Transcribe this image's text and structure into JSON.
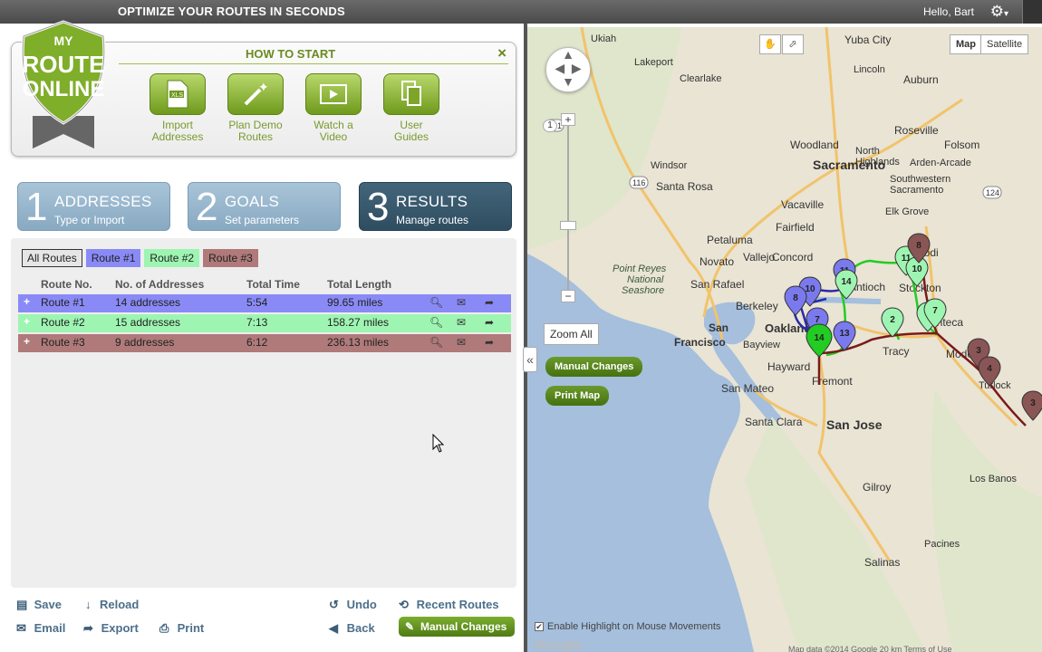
{
  "topbar": {
    "tagline": "OPTIMIZE YOUR ROUTES IN SECONDS",
    "greeting": "Hello, Bart",
    "settings_icon": "gear-icon"
  },
  "logo": {
    "line1": "MY",
    "line2": "ROUTE",
    "line3": "ONLINE"
  },
  "how_to_start": {
    "title": "HOW TO START",
    "close": "×",
    "tiles": [
      {
        "line1": "Import",
        "line2": "Addresses",
        "icon": "xls-file-icon"
      },
      {
        "line1": "Plan Demo",
        "line2": "Routes",
        "icon": "magic-wand-icon"
      },
      {
        "line1": "Watch a",
        "line2": "Video",
        "icon": "film-icon"
      },
      {
        "line1": "User",
        "line2": "Guides",
        "icon": "documents-icon"
      }
    ]
  },
  "steps": [
    {
      "num": "1",
      "title": "ADDRESSES",
      "subtitle": "Type or Import"
    },
    {
      "num": "2",
      "title": "GOALS",
      "subtitle": "Set parameters"
    },
    {
      "num": "3",
      "title": "RESULTS",
      "subtitle": "Manage routes"
    }
  ],
  "filters": [
    "All Routes",
    "Route #1",
    "Route #2",
    "Route #3"
  ],
  "table": {
    "headers": [
      "Route No.",
      "No. of Addresses",
      "Total Time",
      "Total Length"
    ],
    "rows": [
      {
        "route": "Route #1",
        "addresses": "14 addresses",
        "time": "5:54",
        "length": "99.65 miles",
        "color": "#8a8af7"
      },
      {
        "route": "Route #2",
        "addresses": "15 addresses",
        "time": "7:13",
        "length": "158.27 miles",
        "color": "#9ef5b2"
      },
      {
        "route": "Route #3",
        "addresses": "9 addresses",
        "time": "6:12",
        "length": "236.13 miles",
        "color": "#b07a7a"
      }
    ]
  },
  "bottom": {
    "save": "Save",
    "reload": "Reload",
    "undo": "Undo",
    "recent": "Recent Routes",
    "email": "Email",
    "export": "Export",
    "print": "Print",
    "back": "Back",
    "manual": "Manual Changes"
  },
  "map": {
    "type_map": "Map",
    "type_satellite": "Satellite",
    "zoom_all": "Zoom All",
    "manual_changes": "Manual Changes",
    "print_map": "Print Map",
    "highlight": "Enable Highlight on Mouse Movements",
    "google": "Google",
    "attribution": "Map data ©2014 Google   20 km   Terms of Use",
    "cities": [
      "Ukiah",
      "Yuba City",
      "Lakeport",
      "Clearlake",
      "Lincoln",
      "Auburn",
      "Roseville",
      "Woodland",
      "Folsom",
      "Sacramento",
      "North Highlands",
      "Arden-Arcade",
      "Windsor",
      "Southwestern Sacramento",
      "Santa Rosa",
      "Vacaville",
      "Elk Grove",
      "Petaluma",
      "Fairfield",
      "Lodi",
      "Novato",
      "Vallejo",
      "Point Reyes National Seashore",
      "San Rafael",
      "Concord",
      "Antioch",
      "Stockton",
      "Berkeley",
      "Manteca",
      "San Francisco",
      "Oakland",
      "Tracy",
      "Bayview",
      "Hayward",
      "Modesto",
      "San Mateo",
      "Fremont",
      "Turlock",
      "Santa Clara",
      "San Jose",
      "Los Banos",
      "Gilroy",
      "Pacines",
      "Salinas"
    ],
    "highway_labels": [
      "101",
      "116",
      "1",
      "124"
    ],
    "colors": {
      "route1": "#2a2aa8",
      "route2": "#22cc22",
      "route3": "#7a1a1a"
    }
  },
  "collapse_label": "«"
}
